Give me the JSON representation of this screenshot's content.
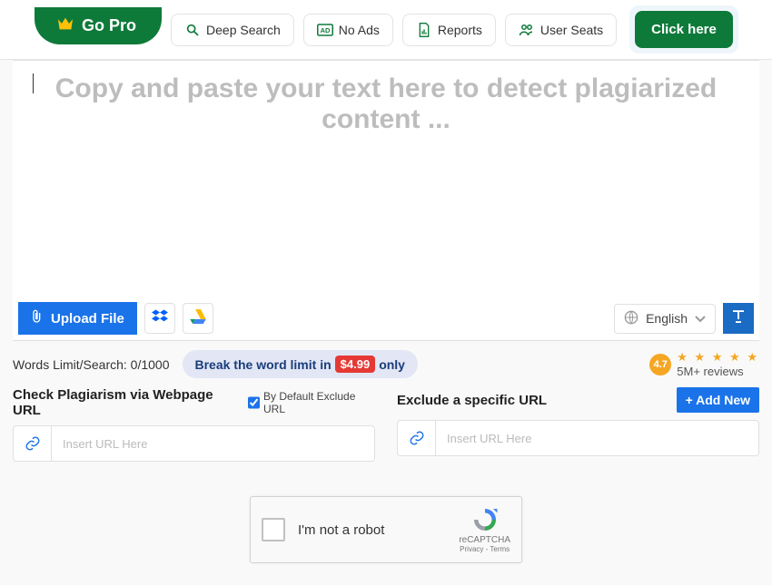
{
  "header": {
    "go_pro_label": "Go Pro",
    "features": {
      "deep_search": "Deep Search",
      "no_ads": "No Ads",
      "reports": "Reports",
      "user_seats": "User Seats"
    },
    "click_here": "Click here"
  },
  "editor": {
    "placeholder": "Copy and paste your text here to detect plagiarized content ..."
  },
  "toolbar": {
    "upload": "Upload File",
    "language": "English"
  },
  "stats": {
    "words_limit_label": "Words Limit/Search: 0/1000",
    "break_limit_prefix": "Break the word limit in",
    "price": "$4.99",
    "break_limit_suffix": "only",
    "rating": "4.7",
    "reviews": "5M+ reviews"
  },
  "url_section": {
    "check_title": "Check Plagiarism via Webpage URL",
    "exclude_checkbox_label": "By Default Exclude URL",
    "exclude_title": "Exclude a specific URL",
    "add_new": "+ Add New",
    "url_placeholder": "Insert URL Here"
  },
  "captcha": {
    "label": "I'm not a robot",
    "brand": "reCAPTCHA",
    "legal": "Privacy - Terms"
  }
}
